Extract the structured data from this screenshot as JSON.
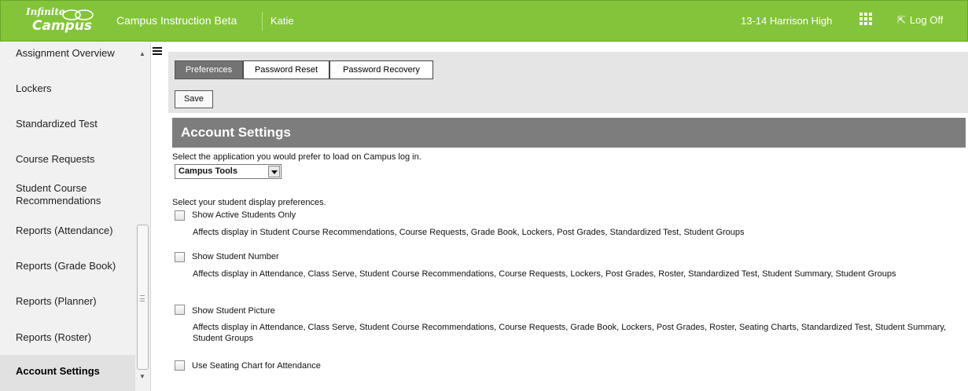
{
  "header": {
    "logo_line1": "Infinite",
    "logo_line2": "Campus",
    "app_title": "Campus Instruction Beta",
    "user": "Katie",
    "school": "13-14 Harrison High",
    "logoff_label": "Log Off",
    "colors": {
      "bar": "#84c43b"
    }
  },
  "sidebar": {
    "items": [
      {
        "label": "Assignment Overview"
      },
      {
        "label": "Lockers"
      },
      {
        "label": "Standardized Test"
      },
      {
        "label": "Course Requests"
      },
      {
        "label": "Student Course Recommendations"
      },
      {
        "label": "Reports (Attendance)"
      },
      {
        "label": "Reports (Grade Book)"
      },
      {
        "label": "Reports (Planner)"
      },
      {
        "label": "Reports (Roster)"
      },
      {
        "label": "Account Settings",
        "active": true
      }
    ]
  },
  "tabs": [
    {
      "label": "Preferences",
      "active": true
    },
    {
      "label": "Password Reset"
    },
    {
      "label": "Password Recovery"
    }
  ],
  "save_label": "Save",
  "section_title": "Account Settings",
  "app_prompt": "Select the application you would prefer to load on Campus log in.",
  "app_select_value": "Campus Tools",
  "display_prompt": "Select your student display preferences.",
  "options": [
    {
      "label": "Show Active Students Only",
      "checked": false,
      "description": "Affects display in Student Course Recommendations, Course Requests, Grade Book, Lockers, Post Grades, Standardized Test, Student Groups"
    },
    {
      "label": "Show Student Number",
      "checked": false,
      "description": "Affects display in Attendance, Class Serve, Student Course Recommendations, Course Requests, Lockers, Post Grades, Roster, Standardized Test, Student Summary, Student Groups"
    },
    {
      "label": "Show Student Picture",
      "checked": false,
      "description": "Affects display in Attendance, Class Serve, Student Course Recommendations, Course Requests, Grade Book, Lockers, Post Grades, Roster, Seating Charts, Standardized Test, Student Summary, Student Groups"
    },
    {
      "label": "Use Seating Chart for Attendance",
      "checked": false
    }
  ]
}
